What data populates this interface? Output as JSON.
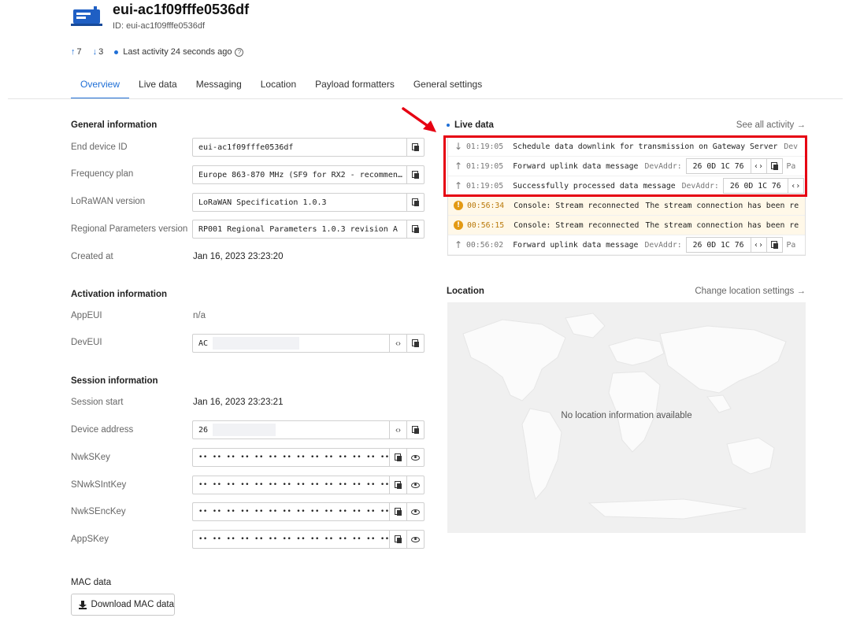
{
  "device": {
    "title": "eui-ac1f09fffe0536df",
    "id_line": "ID: eui-ac1f09fffe0536df"
  },
  "stats": {
    "uplinks": "7",
    "downlinks": "3",
    "last_activity": "Last activity 24 seconds ago"
  },
  "tabs": [
    {
      "label": "Overview",
      "active": true
    },
    {
      "label": "Live data"
    },
    {
      "label": "Messaging"
    },
    {
      "label": "Location"
    },
    {
      "label": "Payload formatters"
    },
    {
      "label": "General settings"
    }
  ],
  "general": {
    "title": "General information",
    "end_device_id_label": "End device ID",
    "end_device_id_value": "eui-ac1f09fffe0536df",
    "frequency_plan_label": "Frequency plan",
    "frequency_plan_value": "Europe 863-870 MHz (SF9 for RX2 - recommen…",
    "lorawan_version_label": "LoRaWAN version",
    "lorawan_version_value": "LoRaWAN Specification 1.0.3",
    "regional_params_label": "Regional Parameters version",
    "regional_params_value": "RP001 Regional Parameters 1.0.3 revision A",
    "created_at_label": "Created at",
    "created_at_value": "Jan 16, 2023 23:23:20"
  },
  "activation": {
    "title": "Activation information",
    "appeui_label": "AppEUI",
    "appeui_value": "n/a",
    "deveui_label": "DevEUI",
    "deveui_value": "AC"
  },
  "session": {
    "title": "Session information",
    "session_start_label": "Session start",
    "session_start_value": "Jan 16, 2023 23:23:21",
    "device_address_label": "Device address",
    "device_address_value": "26",
    "nwkskey_label": "NwkSKey",
    "snwksintkey_label": "SNwkSIntKey",
    "nwksenckey_label": "NwkSEncKey",
    "appskey_label": "AppSKey",
    "masked_value": "•• •• •• •• •• •• •• •• •• •• •• •• •• •• •• ••"
  },
  "mac": {
    "title": "MAC data",
    "download_label": "Download MAC data"
  },
  "live": {
    "title": "Live data",
    "see_all": "See all activity →",
    "devaddr_key": "DevAddr:",
    "devaddr_value": "26 0D 1C 76",
    "events": [
      {
        "time": "01:19:05",
        "message": "Schedule data downlink for transmission on Gateway Server",
        "tail": "Dev"
      },
      {
        "time": "01:19:05",
        "message": "Forward uplink data message",
        "tail": "Pa"
      },
      {
        "time": "01:19:05",
        "message": "Successfully processed data message"
      },
      {
        "time": "00:56:34",
        "message": "Console: Stream reconnected",
        "description": "The stream connection has been re"
      },
      {
        "time": "00:56:15",
        "message": "Console: Stream reconnected",
        "description": "The stream connection has been re"
      },
      {
        "time": "00:56:02",
        "message": "Forward uplink data message",
        "tail": "Pa"
      }
    ]
  },
  "location": {
    "title": "Location",
    "change": "Change location settings →",
    "empty_message": "No location information available"
  }
}
